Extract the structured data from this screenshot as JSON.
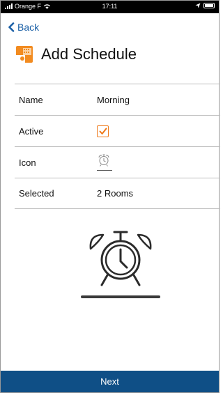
{
  "status_bar": {
    "carrier": "Orange F",
    "time": "17:11",
    "icons": [
      "signal-icon",
      "wifi-icon",
      "location-icon",
      "battery-icon"
    ]
  },
  "nav": {
    "back_label": "Back",
    "back_icon": "chevron-left-icon"
  },
  "header": {
    "title": "Add Schedule",
    "icon": "schedule-calendar-icon"
  },
  "form": {
    "rows": [
      {
        "label": "Name",
        "value": "Morning"
      },
      {
        "label": "Active",
        "value_checked": true
      },
      {
        "label": "Icon",
        "value_icon": "alarm-clock-icon"
      },
      {
        "label": "Selected",
        "value": "2 Rooms"
      }
    ]
  },
  "preview_icon": "alarm-clock-icon",
  "footer": {
    "next_label": "Next"
  },
  "colors": {
    "accent_blue": "#1a5fa6",
    "footer_blue": "#0f4f86",
    "checkbox_orange": "#ef7a1a",
    "app_icon_orange": "#f28b20"
  }
}
